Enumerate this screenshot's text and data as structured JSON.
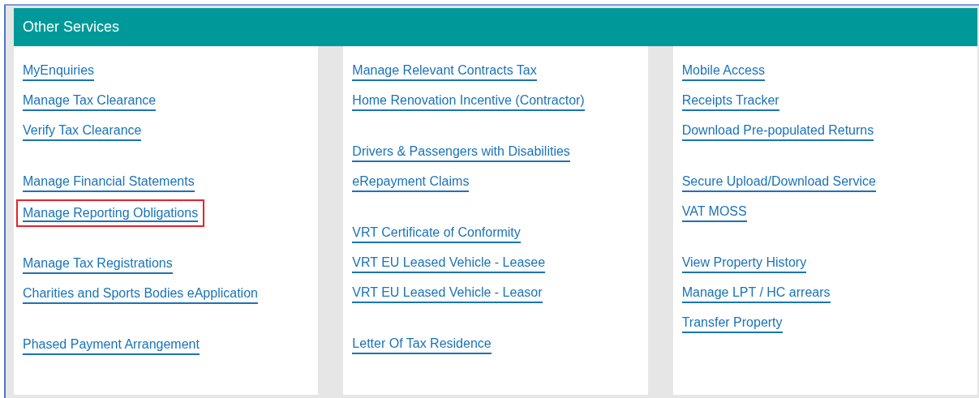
{
  "panel": {
    "title": "Other Services"
  },
  "columns": [
    {
      "groups": [
        [
          {
            "label": "MyEnquiries",
            "highlighted": false
          },
          {
            "label": "Manage Tax Clearance",
            "highlighted": false
          },
          {
            "label": "Verify Tax Clearance",
            "highlighted": false
          }
        ],
        [
          {
            "label": "Manage Financial Statements",
            "highlighted": false
          },
          {
            "label": "Manage Reporting Obligations",
            "highlighted": true
          }
        ],
        [
          {
            "label": "Manage Tax Registrations",
            "highlighted": false
          },
          {
            "label": "Charities and Sports Bodies eApplication",
            "highlighted": false
          }
        ],
        [
          {
            "label": "Phased Payment Arrangement",
            "highlighted": false
          }
        ]
      ]
    },
    {
      "groups": [
        [
          {
            "label": "Manage Relevant Contracts Tax",
            "highlighted": false
          },
          {
            "label": "Home Renovation Incentive (Contractor)",
            "highlighted": false
          }
        ],
        [
          {
            "label": "Drivers & Passengers with Disabilities",
            "highlighted": false
          },
          {
            "label": "eRepayment Claims",
            "highlighted": false
          }
        ],
        [
          {
            "label": "VRT Certificate of Conformity",
            "highlighted": false
          },
          {
            "label": "VRT EU Leased Vehicle - Leasee",
            "highlighted": false
          },
          {
            "label": "VRT EU Leased Vehicle - Leasor",
            "highlighted": false
          }
        ],
        [
          {
            "label": "Letter Of Tax Residence",
            "highlighted": false
          }
        ]
      ]
    },
    {
      "groups": [
        [
          {
            "label": "Mobile Access",
            "highlighted": false
          },
          {
            "label": "Receipts Tracker",
            "highlighted": false
          },
          {
            "label": "Download Pre-populated Returns",
            "highlighted": false
          }
        ],
        [
          {
            "label": "Secure Upload/Download Service",
            "highlighted": false
          },
          {
            "label": "VAT MOSS",
            "highlighted": false
          }
        ],
        [
          {
            "label": "View Property History",
            "highlighted": false
          },
          {
            "label": "Manage LPT / HC arrears",
            "highlighted": false
          },
          {
            "label": "Transfer Property",
            "highlighted": false
          }
        ]
      ]
    }
  ]
}
